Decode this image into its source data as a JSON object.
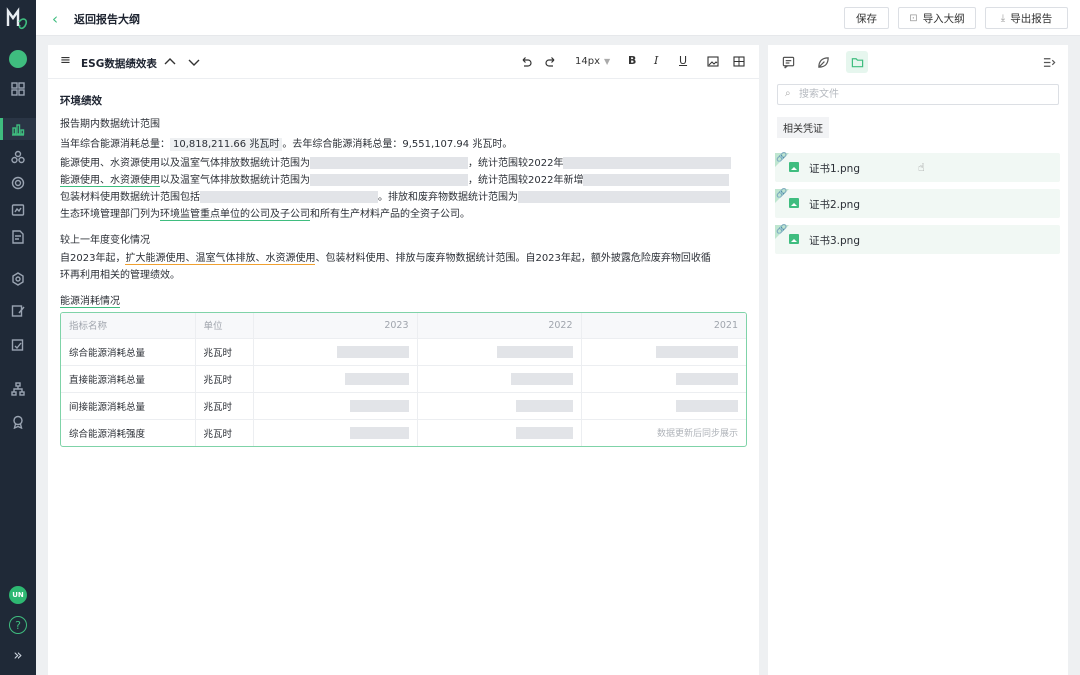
{
  "topbar": {
    "back_label": "返回报告大纲",
    "save_label": "保存",
    "import_label": "导入大纲",
    "export_label": "导出报告"
  },
  "sidebar": {
    "avatar_initials": "UN",
    "help_glyph": "?",
    "expand_glyph": "»",
    "accent_color": "#3fbd7f"
  },
  "editor": {
    "doc_title": "ESG数据绩效表",
    "font_size": "14px",
    "section_title": "环境绩效",
    "p_scope_title": "报告期内数据统计范围",
    "p_energy_a": "当年综合能源消耗总量：",
    "p_energy_value": "10,818,211.66 兆瓦时",
    "p_energy_b": "。去年综合能源消耗总量：9,551,107.94 兆瓦时。",
    "p_line1_a": "能源使用、水资源使用以及温室气体排放数据统计范围为",
    "p_line1_b": "，统计范围较2022年",
    "p_line2_a": "能源使用、水资源使用",
    "p_line2_b": "以及温室气体排放数据统计范围为",
    "p_line2_c": "，统计范围较2022年新增",
    "p_line3_a": "包装材料使用数据统计范围包括",
    "p_line3_b": "。排放和废弃物数据统计范围为",
    "p_line4_a": "生态环境管理部门列为",
    "p_line4_b": "环境监管重点单位的公司及子公司",
    "p_line4_c": "和所有生产材料产品的全资子公司。",
    "change_title": "较上一年度变化情况",
    "change_a": "自2023年起，",
    "change_b": "扩大能源使用、温室气体排放、水资源使用",
    "change_c": "、包装材料使用、排放与废弃物数据统计范围。自2023年起，额外披露危险废弃物回收循",
    "change_d": "环再利用相关的管理绩效。",
    "energy_heading": "能源消耗情况"
  },
  "table": {
    "headers": [
      "指标名称",
      "单位",
      "2023",
      "2022",
      "2021"
    ],
    "rows": [
      {
        "name": "综合能源消耗总量",
        "unit": "兆瓦时"
      },
      {
        "name": "直接能源消耗总量",
        "unit": "兆瓦时"
      },
      {
        "name": "间接能源消耗总量",
        "unit": "兆瓦时"
      },
      {
        "name": "综合能源消耗强度",
        "unit": "兆瓦时",
        "note_2021": "数据更新后同步展示"
      }
    ]
  },
  "right_panel": {
    "search_placeholder": "搜索文件",
    "tag": "相关凭证",
    "files": [
      "证书1.png",
      "证书2.png",
      "证书3.png"
    ]
  }
}
